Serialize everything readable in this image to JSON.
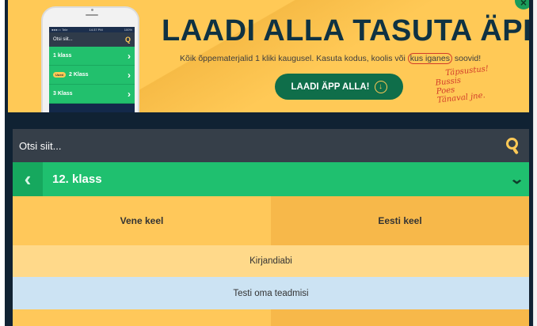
{
  "banner": {
    "headline": "LAADI ALLA TASUTA ÄPP!",
    "subline_prefix": "Kõik õppematerjalid 1 kliki kaugusel. Kasuta kodus, koolis või ",
    "subline_circled": "kus iganes",
    "subline_suffix": " soovid!",
    "download_label": "LAADI ÄPP ALLA!",
    "handwritten": [
      "Täpsustus!",
      "Bussis",
      "Poes",
      "Tänaval jne."
    ],
    "phone": {
      "status_left": "●●●○○ Tele",
      "status_time": "14:37 PM",
      "status_right": "100%",
      "search_placeholder": "Otsi siit...",
      "rows": [
        {
          "label": "1 klass",
          "badge": ""
        },
        {
          "label": "2 Klass",
          "badge": "Uued"
        },
        {
          "label": "3 Klass",
          "badge": ""
        }
      ]
    }
  },
  "search": {
    "placeholder": "Otsi siit..."
  },
  "classbar": {
    "title": "12. klass"
  },
  "subjects": [
    "Vene keel",
    "Eesti keel"
  ],
  "sections": {
    "kirjandiabi": "Kirjandiabi",
    "test": "Testi oma teadmisi"
  },
  "colors": {
    "banner_bg": "#ffc956",
    "green": "#1fc06f",
    "dark": "#102233",
    "search_bg": "#363f49",
    "test_bg": "#cce3f3"
  },
  "icons": {
    "close": "close-icon",
    "search": "search-icon",
    "back": "chevron-left-icon",
    "expand": "chevron-down-icon",
    "download": "download-icon"
  }
}
